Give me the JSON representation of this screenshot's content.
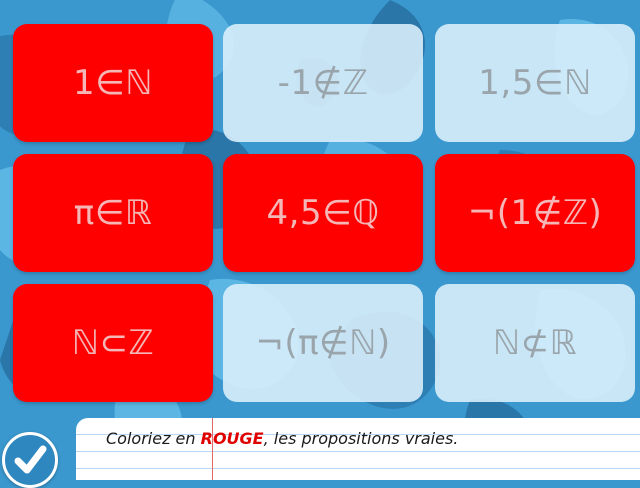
{
  "colors": {
    "background": "#3a98cf",
    "card_selected": "#ff0000",
    "card_unselected": "#dcf0fc",
    "keyword": "#e00000"
  },
  "cards": [
    {
      "label": "1∈ℕ",
      "state": "red"
    },
    {
      "label": "-1∉ℤ",
      "state": "pale"
    },
    {
      "label": "1,5∈ℕ",
      "state": "pale"
    },
    {
      "label": "π∈ℝ",
      "state": "red"
    },
    {
      "label": "4,5∈ℚ",
      "state": "red"
    },
    {
      "label": "¬(1∉ℤ)",
      "state": "red"
    },
    {
      "label": "ℕ⊂ℤ",
      "state": "red"
    },
    {
      "label": "¬(π∉ℕ)",
      "state": "pale"
    },
    {
      "label": "ℕ⊄ℝ",
      "state": "pale"
    }
  ],
  "instruction": {
    "before": "Coloriez en ",
    "keyword": "ROUGE",
    "after": ", les propositions vraies."
  },
  "validate_button": {
    "icon": "checkmark-icon"
  }
}
